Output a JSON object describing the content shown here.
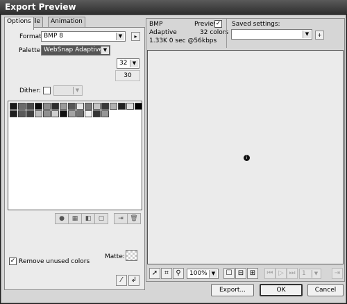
{
  "window": {
    "title": "Export Preview"
  },
  "tabs": [
    {
      "label": "Options",
      "active": true
    },
    {
      "label": "File",
      "active": false
    },
    {
      "label": "Animation",
      "active": false
    }
  ],
  "options": {
    "format_label": "Format:",
    "format_value": "BMP 8",
    "palette_label": "Palette:",
    "palette_value": "WebSnap Adaptive",
    "colors_value": "32",
    "colors_count": "30",
    "dither_label": "Dither:",
    "matte_label": "Matte:",
    "remove_unused_label": "Remove unused colors",
    "remove_unused_checked": true,
    "palette_swatch_colors": [
      "#1a1a1a",
      "#6b6b6b",
      "#4a4a4a",
      "#0d0d0d",
      "#8a8a8a",
      "#2d2d2d",
      "#9a9a9a",
      "#555555",
      "#e6e6e6",
      "#7a7a7a",
      "#c4c4c4",
      "#3a3a3a",
      "#b0b0b0",
      "#202020",
      "#dcdcdc",
      "#000000",
      "#1f1f1f",
      "#5a5a5a",
      "#404040",
      "#bdbdbd",
      "#8f8f8f",
      "#cfcfcf",
      "#111111",
      "#a3a3a3",
      "#727272",
      "#f2f2f2",
      "#343434",
      "#969696"
    ],
    "palette_tool_icons": [
      "circle-icon",
      "grid-icon",
      "transparent-icon",
      "lock-icon",
      "add-swatch-icon",
      "delete-swatch-icon"
    ]
  },
  "preview": {
    "format": "BMP",
    "palette": "Adaptive",
    "filesize": "1.33K  0 sec @56kbps",
    "preview_label": "Preview",
    "preview_checked": true,
    "colors_label": "32 colors",
    "saved_settings_label": "Saved settings:",
    "saved_settings_value": ""
  },
  "toolbar": {
    "zoom_value": "100%",
    "frame_value": "1"
  },
  "buttons": {
    "export": "Export...",
    "ok": "OK",
    "cancel": "Cancel"
  }
}
